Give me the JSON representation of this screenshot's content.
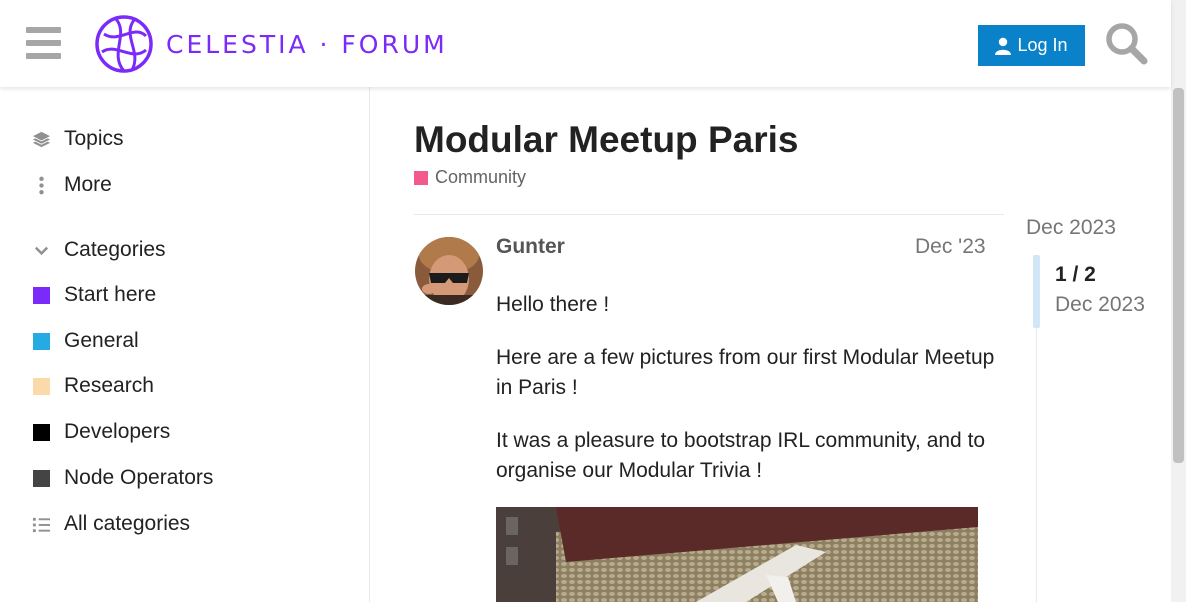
{
  "header": {
    "brand_text": "CELESTIA · FORUM",
    "login_label": "Log In",
    "brand_color": "#7b2bf9",
    "login_color": "#0a82c9"
  },
  "sidebar": {
    "topics_label": "Topics",
    "more_label": "More",
    "categories_label": "Categories",
    "categories": [
      {
        "label": "Start here",
        "color": "#7b2bf9"
      },
      {
        "label": "General",
        "color": "#25aae1"
      },
      {
        "label": "Research",
        "color": "#fcd9a9"
      },
      {
        "label": "Developers",
        "color": "#000000"
      },
      {
        "label": "Node Operators",
        "color": "#444444"
      }
    ],
    "all_categories_label": "All categories"
  },
  "topic": {
    "title": "Modular Meetup Paris",
    "category": "Community",
    "category_color": "#f15a8a"
  },
  "post": {
    "author": "Gunter",
    "date": "Dec '23",
    "paragraphs": [
      "Hello there !",
      "Here are a few pictures from our first Modular Meetup in Paris !",
      "It was a pleasure to bootstrap IRL community, and to organise our Modular Trivia !"
    ]
  },
  "timeline": {
    "start_date": "Dec 2023",
    "position": "1 / 2",
    "current_date": "Dec 2023"
  }
}
